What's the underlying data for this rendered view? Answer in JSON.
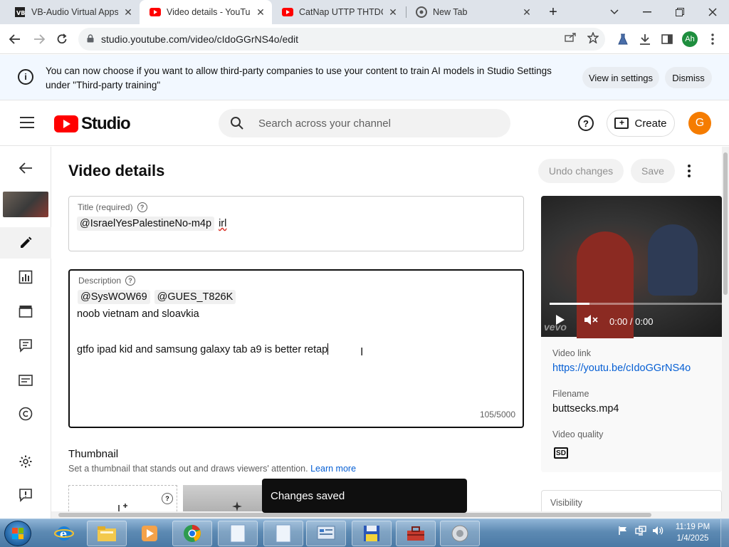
{
  "browser": {
    "tabs": [
      {
        "title": "VB-Audio Virtual Apps",
        "favicon": "vb-audio-icon",
        "active": false
      },
      {
        "title": "Video details - YouTube Studio",
        "favicon": "youtube-icon",
        "active": true
      },
      {
        "title": "CatNap UTTP THTDC",
        "favicon": "youtube-icon",
        "active": false
      },
      {
        "title": "New Tab",
        "favicon": "chrome-icon",
        "active": false
      }
    ],
    "close_glyph": "✕",
    "new_tab_glyph": "+",
    "url": "studio.youtube.com/video/cIdoGGrNS4o/edit",
    "profile_initials": "Ah"
  },
  "banner": {
    "message": "You can now choose if you want to allow third-party companies to use your content to train AI models in Studio Settings under \"Third-party training\"",
    "view_settings": "View in settings",
    "dismiss": "Dismiss"
  },
  "header": {
    "brand": "Studio",
    "search_placeholder": "Search across your channel",
    "create_label": "Create",
    "avatar_initial": "G"
  },
  "main": {
    "page_title": "Video details",
    "undo_label": "Undo changes",
    "save_label": "Save",
    "title_field": {
      "label": "Title (required)",
      "mention": "@IsraelYesPalestineNo-m4p",
      "text": "irl"
    },
    "description_field": {
      "label": "Description",
      "mentions": [
        "@SysWOW69",
        "@GUES_T826K"
      ],
      "line1": "noob vietnam and sloavkia",
      "line2": "gtfo ipad kid and samsung galaxy tab a9 is better retap",
      "counter": "105/5000"
    },
    "thumbnail": {
      "heading": "Thumbnail",
      "subtext": "Set a thumbnail that stands out and draws viewers' attention.",
      "learn_more": "Learn more"
    }
  },
  "video_panel": {
    "time": "0:00 / 0:00",
    "watermark": "vevo",
    "link_label": "Video link",
    "link": "https://youtu.be/cIdoGGrNS4o",
    "filename_label": "Filename",
    "filename": "buttsecks.mp4",
    "quality_label": "Video quality",
    "quality_badge": "SD",
    "visibility_label": "Visibility"
  },
  "toast": {
    "message": "Changes saved"
  },
  "taskbar": {
    "time": "11:19 PM",
    "date": "1/4/2025"
  },
  "colors": {
    "youtube_red": "#ff0000",
    "link_blue": "#065fd4",
    "avatar_orange": "#f57c00",
    "profile_green": "#1e8e3e"
  }
}
